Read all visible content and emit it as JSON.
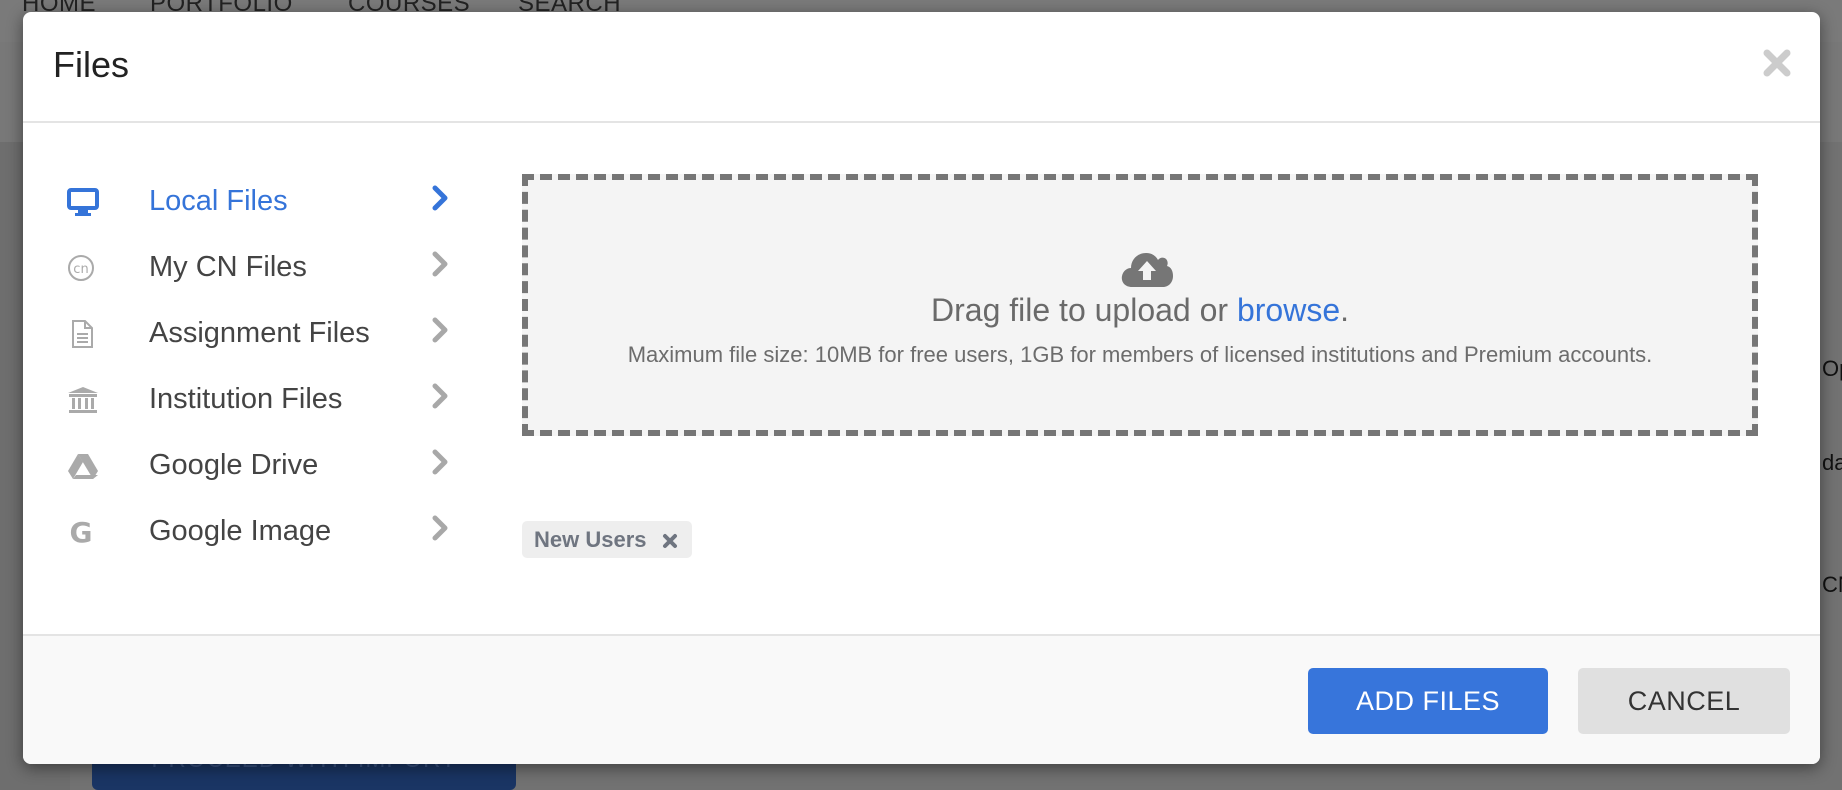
{
  "background": {
    "nav_items": [
      "HOME",
      "PORTFOLIO",
      "COURSES",
      "SEARCH"
    ],
    "side_fragments": [
      "Opt",
      "da",
      "CN"
    ],
    "proceed_button": "PROCEED WITH IMPORT"
  },
  "modal": {
    "title": "Files",
    "close_icon": "close-icon"
  },
  "sidebar": {
    "items": [
      {
        "label": "Local Files",
        "icon": "desktop-icon",
        "active": true
      },
      {
        "label": "My CN Files",
        "icon": "cn-logo-icon",
        "active": false
      },
      {
        "label": "Assignment Files",
        "icon": "document-icon",
        "active": false
      },
      {
        "label": "Institution Files",
        "icon": "institution-icon",
        "active": false
      },
      {
        "label": "Google Drive",
        "icon": "google-drive-icon",
        "active": false
      },
      {
        "label": "Google Image",
        "icon": "google-icon",
        "active": false
      }
    ]
  },
  "dropzone": {
    "icon": "cloud-upload-icon",
    "text_before": "Drag file to upload or ",
    "browse_link": "browse",
    "text_after": ".",
    "subtext": "Maximum file size: 10MB for free users, 1GB for members of licensed institutions and Premium accounts."
  },
  "tags": [
    {
      "label": "New Users",
      "remove_icon": "remove-icon"
    }
  ],
  "footer": {
    "add_files_label": "ADD FILES",
    "cancel_label": "CANCEL"
  },
  "colors": {
    "accent": "#3574d9",
    "primary_button": "#3775db",
    "secondary_button": "#e0e0e0",
    "overlay": "#6e6e6e"
  }
}
